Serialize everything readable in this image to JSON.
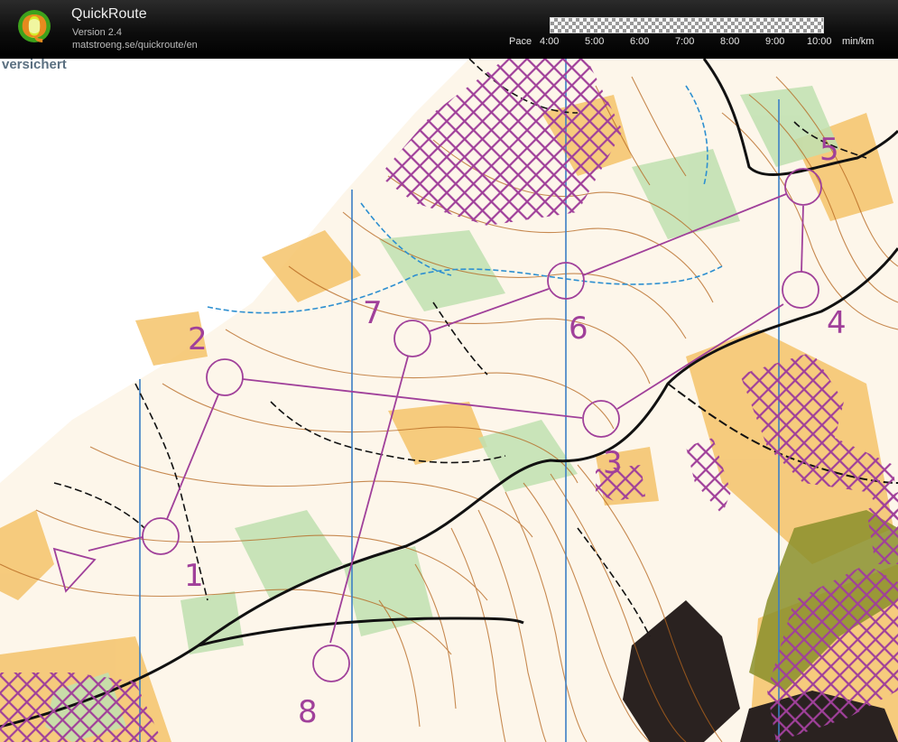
{
  "app": {
    "title": "QuickRoute",
    "version": "Version 2.4",
    "url": "matstroeng.se/quickroute/en",
    "logo_letter": "Q"
  },
  "pace": {
    "label": "Pace",
    "ticks": [
      "4:00",
      "5:00",
      "6:00",
      "7:00",
      "8:00",
      "9:00",
      "10:00"
    ],
    "unit": "min/km"
  },
  "map": {
    "corner_text": "versichert",
    "control_numbers": [
      "1",
      "2",
      "3",
      "4",
      "5",
      "6",
      "7",
      "8"
    ]
  },
  "colors": {
    "course": "#a0409a",
    "contour": "#b5651d",
    "open_land": "#f4c36a",
    "vegetation": "#bfe0b0",
    "water": "#2d8fd0",
    "magnetic_north": "#3b7fc4",
    "path": "#111111",
    "header_bg": "#111111"
  }
}
